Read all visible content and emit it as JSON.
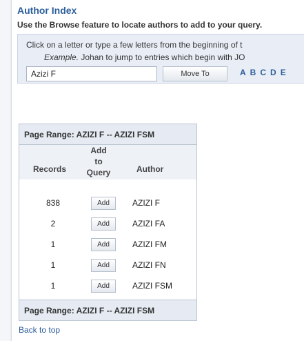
{
  "title": "Author Index",
  "subtitle": "Use the Browse feature to locate authors to add to your query.",
  "instructions": "Click on a letter or type a few letters from the beginning of t",
  "example_label": "Example.",
  "example_text": "Johan to jump to entries which begin with JO",
  "search": {
    "value": "Azizi F",
    "button": "Move To"
  },
  "letters": [
    "A",
    "B",
    "C",
    "D",
    "E"
  ],
  "page_range_top": "Page Range: AZIZI F -- AZIZI FSM",
  "page_range_bottom": "Page Range: AZIZI F -- AZIZI FSM",
  "columns": {
    "records": "Records",
    "add": "Add to Query",
    "author": "Author"
  },
  "rows": [
    {
      "records": "838",
      "button": "Add",
      "author": "AZIZI F"
    },
    {
      "records": "2",
      "button": "Add",
      "author": "AZIZI FA"
    },
    {
      "records": "1",
      "button": "Add",
      "author": "AZIZI FM"
    },
    {
      "records": "1",
      "button": "Add",
      "author": "AZIZI FN"
    },
    {
      "records": "1",
      "button": "Add",
      "author": "AZIZI FSM"
    }
  ],
  "back_link": "Back to top"
}
